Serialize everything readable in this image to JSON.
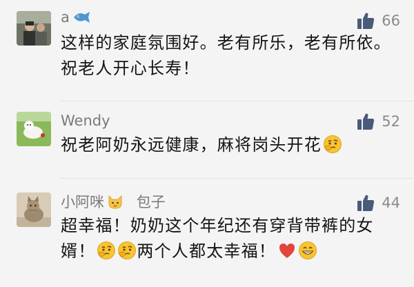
{
  "comments": [
    {
      "user": "a",
      "user_icon": "fish-emoji",
      "likes": "66",
      "text": "这样的家庭氛围好。老有所乐，老有所依。祝老人开心长寿！"
    },
    {
      "user": "Wendy",
      "likes": "52",
      "text": "祝老阿奶永远健康，麻将岗头开花",
      "text_emojis": [
        "thinking-face-emoji"
      ]
    },
    {
      "user": "小阿咪",
      "user_icon": "cat-face-emoji",
      "user_suffix": "包子",
      "likes": "44",
      "text_a": "超幸福！奶奶这个年纪还有穿背带裤的女婿！",
      "text_b": "两个人都太幸福！",
      "text_emojis": [
        "thinking-face-emoji",
        "thinking-face-emoji",
        "red-heart-emoji",
        "grinning-face-emoji"
      ]
    }
  ],
  "colors": {
    "background": "#f4f4f4",
    "like_icon": "#4a5a79",
    "name_text": "#7a7a7a"
  }
}
